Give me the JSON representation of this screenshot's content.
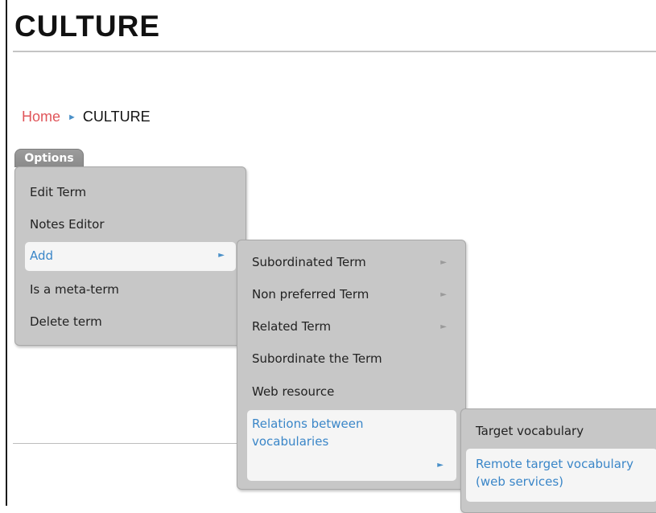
{
  "page": {
    "title": "CULTURE"
  },
  "breadcrumb": {
    "home": "Home",
    "separator": "►",
    "current": "CULTURE"
  },
  "options": {
    "tab_label": "Options"
  },
  "menu_main": {
    "items": [
      {
        "label": "Edit Term"
      },
      {
        "label": "Notes Editor"
      },
      {
        "label": "Add",
        "submenu_arrow": "►"
      },
      {
        "label": "Is a meta-term"
      },
      {
        "label": "Delete term"
      }
    ]
  },
  "menu_add": {
    "items": [
      {
        "label": "Subordinated Term",
        "submenu_arrow": "►"
      },
      {
        "label": "Non preferred Term",
        "submenu_arrow": "►"
      },
      {
        "label": "Related Term",
        "submenu_arrow": "►"
      },
      {
        "label": "Subordinate the Term"
      },
      {
        "label": "Web resource"
      },
      {
        "label": "Relations between vocabularies",
        "submenu_arrow": "►"
      }
    ]
  },
  "menu_relations": {
    "items": [
      {
        "label": "Target vocabulary"
      },
      {
        "label": "Remote target vocabulary (web services)"
      }
    ]
  },
  "colors": {
    "link": "#e0555a",
    "highlight_text": "#3a86c8",
    "menu_bg": "#c7c7c7",
    "tab_bg": "#8f8f8f"
  }
}
